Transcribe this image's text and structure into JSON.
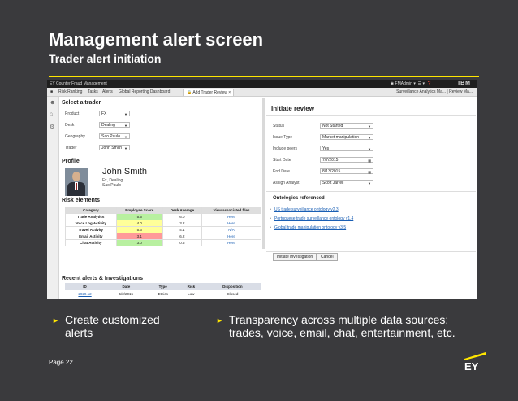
{
  "slide": {
    "title": "Management alert screen",
    "subtitle": "Trader alert initiation",
    "page": "Page 22",
    "logo": "EY",
    "bullets": [
      {
        "line1": "Create customized",
        "line2": "alerts"
      },
      {
        "line1": "Transparency across multiple data sources:",
        "line2": "trades, voice, email, chat, entertainment, etc."
      }
    ],
    "colors": {
      "background": "#3a3a3d",
      "accent": "#ffe600"
    }
  },
  "app": {
    "window_title": "EY Counter Fraud Management",
    "user": "FMAdmin",
    "brand": "IBM",
    "tabs": [
      "Risk Ranking",
      "Tasks",
      "Alerts",
      "Global Reporting Dashboard",
      "Add Trader Review"
    ],
    "right_tabs": "Surveillance Analytics Ma... | Review Ma...",
    "side_icons": [
      "person-icon",
      "home-icon",
      "gear-icon"
    ]
  },
  "select_trader": {
    "heading": "Select a trader",
    "fields": [
      {
        "label": "Product",
        "value": "FX"
      },
      {
        "label": "Desk",
        "value": "Dealing"
      },
      {
        "label": "Geography",
        "value": "Sao Paulo"
      },
      {
        "label": "Trader",
        "value": "John Smith"
      }
    ]
  },
  "profile": {
    "heading": "Profile",
    "name": "John Smith",
    "line1": "Fx, Dealing",
    "line2": "Sao Paulo"
  },
  "risk": {
    "heading": "Risk elements",
    "columns": [
      "Category",
      "Employee Score",
      "Desk Average",
      "View associated files"
    ],
    "rows": [
      {
        "category": "Trade Analytics",
        "score": "5.5",
        "avg": "6.0",
        "link": "Here",
        "color": "#b8f0a0"
      },
      {
        "category": "Voice Log Activity",
        "score": "4.0",
        "avg": "3.2",
        "link": "Here",
        "color": "#ffff99"
      },
      {
        "category": "Travel Activity",
        "score": "5.3",
        "avg": "4.1",
        "link": "N/A",
        "color": "#ffff99"
      },
      {
        "category": "Email Activity",
        "score": "3.1",
        "avg": "6.2",
        "link": "Here",
        "color": "#ff9999"
      },
      {
        "category": "Chat Activity",
        "score": "3.0",
        "avg": "0.5",
        "link": "Here",
        "color": "#b8f0a0"
      }
    ]
  },
  "recent": {
    "heading": "Recent alerts & Investigations",
    "columns": [
      "ID",
      "Date",
      "Type",
      "Risk",
      "Disposition"
    ],
    "rows": [
      {
        "id": "2929.12",
        "date": "5/2/2015",
        "type": "Ethics",
        "risk": "Low",
        "disposition": "Closed"
      }
    ]
  },
  "initiate": {
    "heading": "Initiate review",
    "fields": [
      {
        "label": "Status",
        "value": "Not Started",
        "kind": "select"
      },
      {
        "label": "Issue Type",
        "value": "Market manipulation",
        "kind": "select"
      },
      {
        "label": "Include peers",
        "value": "Yes",
        "kind": "select"
      },
      {
        "label": "Start Date",
        "value": "7/7/2015",
        "kind": "date"
      },
      {
        "label": "End Date",
        "value": "8/13/2015",
        "kind": "date"
      },
      {
        "label": "Assign Analyst",
        "value": "Scott Jarrell",
        "kind": "select"
      }
    ],
    "ontologies_heading": "Ontologies referenced",
    "ontologies": [
      "US trade surveillance ontology   v2.3",
      "Portuguese trade surveillance ontology   v1.4",
      "Global trade manipulation ontology   v3.5"
    ],
    "initiate_button": "Initiate Investigation",
    "cancel_button": "Cancel"
  }
}
